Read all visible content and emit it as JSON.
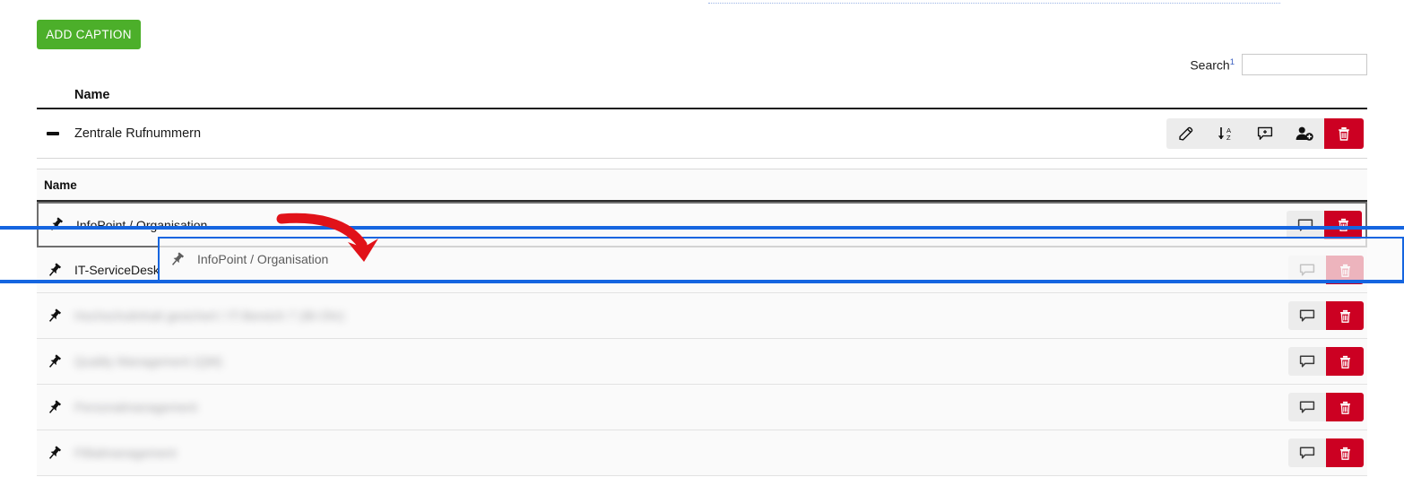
{
  "toolbar": {
    "add_caption_label": "ADD CAPTION"
  },
  "search": {
    "label": "Search",
    "footnote": "1",
    "value": "",
    "placeholder": ""
  },
  "outer_table": {
    "header": {
      "name": "Name"
    },
    "rows": [
      {
        "title": "Zentrale Rufnummern",
        "collapse_icon": "minus-icon",
        "actions": [
          {
            "name": "edit-button",
            "icon": "pencil-icon"
          },
          {
            "name": "sort-button",
            "icon": "sort-alpha-down-icon"
          },
          {
            "name": "add-comment-button",
            "icon": "comment-plus-icon"
          },
          {
            "name": "add-user-button",
            "icon": "user-plus-icon"
          },
          {
            "name": "delete-button",
            "icon": "trash-icon"
          }
        ]
      }
    ]
  },
  "inner_table": {
    "header": {
      "name": "Name"
    },
    "rows": [
      {
        "title": "InfoPoint / Organisation",
        "icon": "pin-icon",
        "redacted": false,
        "dragging": true
      },
      {
        "title": "IT-ServiceDesk",
        "icon": "pin-icon",
        "redacted": false,
        "dragging": false
      },
      {
        "title": "Hochschulinhalt gesichert / IT-Bereich 7 (IB-Ohr)",
        "icon": "pin-icon",
        "redacted": true,
        "dragging": false
      },
      {
        "title": "Quality Management (QM)",
        "icon": "pin-icon",
        "redacted": true,
        "dragging": false
      },
      {
        "title": "Personalmanagement",
        "icon": "pin-icon",
        "redacted": true,
        "dragging": false
      },
      {
        "title": "Fillialmanagement",
        "icon": "pin-icon",
        "redacted": true,
        "dragging": false
      }
    ],
    "row_actions": [
      {
        "name": "comment-button",
        "icon": "comment-icon"
      },
      {
        "name": "delete-button",
        "icon": "trash-icon"
      }
    ]
  },
  "drag_state": {
    "ghost_label": "InfoPoint / Organisation",
    "ghost_icon": "pin-icon",
    "drop_indicator_color": "#1565e0"
  },
  "annotation": {
    "arrow": "red-curved-arrow",
    "color": "#e11219"
  },
  "colors": {
    "accent_green": "#4caf2a",
    "danger_red": "#cc0022",
    "drop_blue": "#1565e0",
    "annotation_red": "#e11219",
    "icon_bg": "#ececec"
  }
}
